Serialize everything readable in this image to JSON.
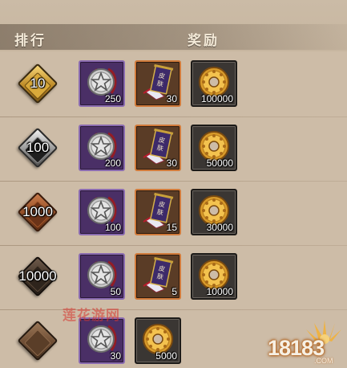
{
  "header": {
    "rank_label": "排行",
    "reward_label": "奖励"
  },
  "rows": [
    {
      "rank": "10",
      "badge": "gold",
      "rewards": [
        {
          "icon": "star-medal-icon",
          "frame": "purple",
          "count": "250"
        },
        {
          "icon": "scroll-banner-icon",
          "frame": "orange",
          "count": "30"
        },
        {
          "icon": "gold-coin-ring-icon",
          "frame": "black",
          "count": "100000"
        }
      ]
    },
    {
      "rank": "100",
      "badge": "silver",
      "rewards": [
        {
          "icon": "star-medal-icon",
          "frame": "purple",
          "count": "200"
        },
        {
          "icon": "scroll-banner-icon",
          "frame": "orange",
          "count": "30"
        },
        {
          "icon": "gold-coin-ring-icon",
          "frame": "black",
          "count": "50000"
        }
      ]
    },
    {
      "rank": "1000",
      "badge": "bronze",
      "rewards": [
        {
          "icon": "star-medal-icon",
          "frame": "purple",
          "count": "100"
        },
        {
          "icon": "scroll-banner-icon",
          "frame": "orange",
          "count": "15"
        },
        {
          "icon": "gold-coin-ring-icon",
          "frame": "black",
          "count": "30000"
        }
      ]
    },
    {
      "rank": "10000",
      "badge": "dark",
      "rewards": [
        {
          "icon": "star-medal-icon",
          "frame": "purple",
          "count": "50"
        },
        {
          "icon": "scroll-banner-icon",
          "frame": "orange",
          "count": "5"
        },
        {
          "icon": "gold-coin-ring-icon",
          "frame": "black",
          "count": "10000"
        }
      ]
    },
    {
      "rank": "",
      "badge": "brown",
      "rewards": [
        {
          "icon": "star-medal-icon",
          "frame": "purple",
          "count": "30"
        },
        {
          "icon": "gold-coin-ring-icon",
          "frame": "black",
          "count": "5000"
        }
      ]
    }
  ],
  "scroll_text": "皮肤",
  "watermark": {
    "red_text": "莲花游网",
    "logo_text": "18183",
    "logo_sub": ".COM"
  },
  "colors": {
    "purple_frame": "#8a6bb0",
    "orange_frame": "#d07a3a",
    "black_frame": "#1c1a18",
    "gold": "#d9a93a"
  }
}
